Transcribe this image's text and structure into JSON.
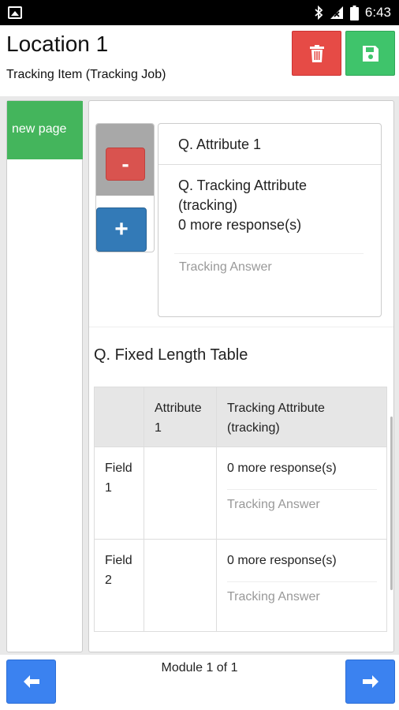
{
  "status_bar": {
    "time": "6:43",
    "icons": [
      "image-notification-icon",
      "bluetooth-icon",
      "signal-icon",
      "battery-icon"
    ]
  },
  "header": {
    "title": "Location 1",
    "subtitle": "Tracking Item (Tracking Job)",
    "delete_icon": "trash-icon",
    "save_icon": "floppy-disk-icon",
    "colors": {
      "delete": "#e64b46",
      "save": "#3fc46b"
    }
  },
  "sidebar": {
    "pages": [
      {
        "label": "new page",
        "color": "#44b55c"
      }
    ]
  },
  "question_card": {
    "header": "Q. Attribute 1",
    "tracking_question": "Q. Tracking Attribute (tracking)",
    "responses": "0 more response(s)",
    "answer_placeholder": "Tracking Answer",
    "remove_label": "-",
    "add_label": "+"
  },
  "table": {
    "title": "Q. Fixed Length Table",
    "columns": [
      "",
      "Attribute 1",
      "Tracking Attribute (tracking)"
    ],
    "rows": [
      {
        "field": "Field 1",
        "attribute": "",
        "responses": "0 more response(s)",
        "answer_placeholder": "Tracking Answer"
      },
      {
        "field": "Field 2",
        "attribute": "",
        "responses": "0 more response(s)",
        "answer_placeholder": "Tracking Answer"
      }
    ]
  },
  "footer": {
    "module_text": "Module 1 of 1",
    "prev_icon": "arrow-left-icon",
    "next_icon": "arrow-right-icon",
    "color": "#3b82f0"
  }
}
